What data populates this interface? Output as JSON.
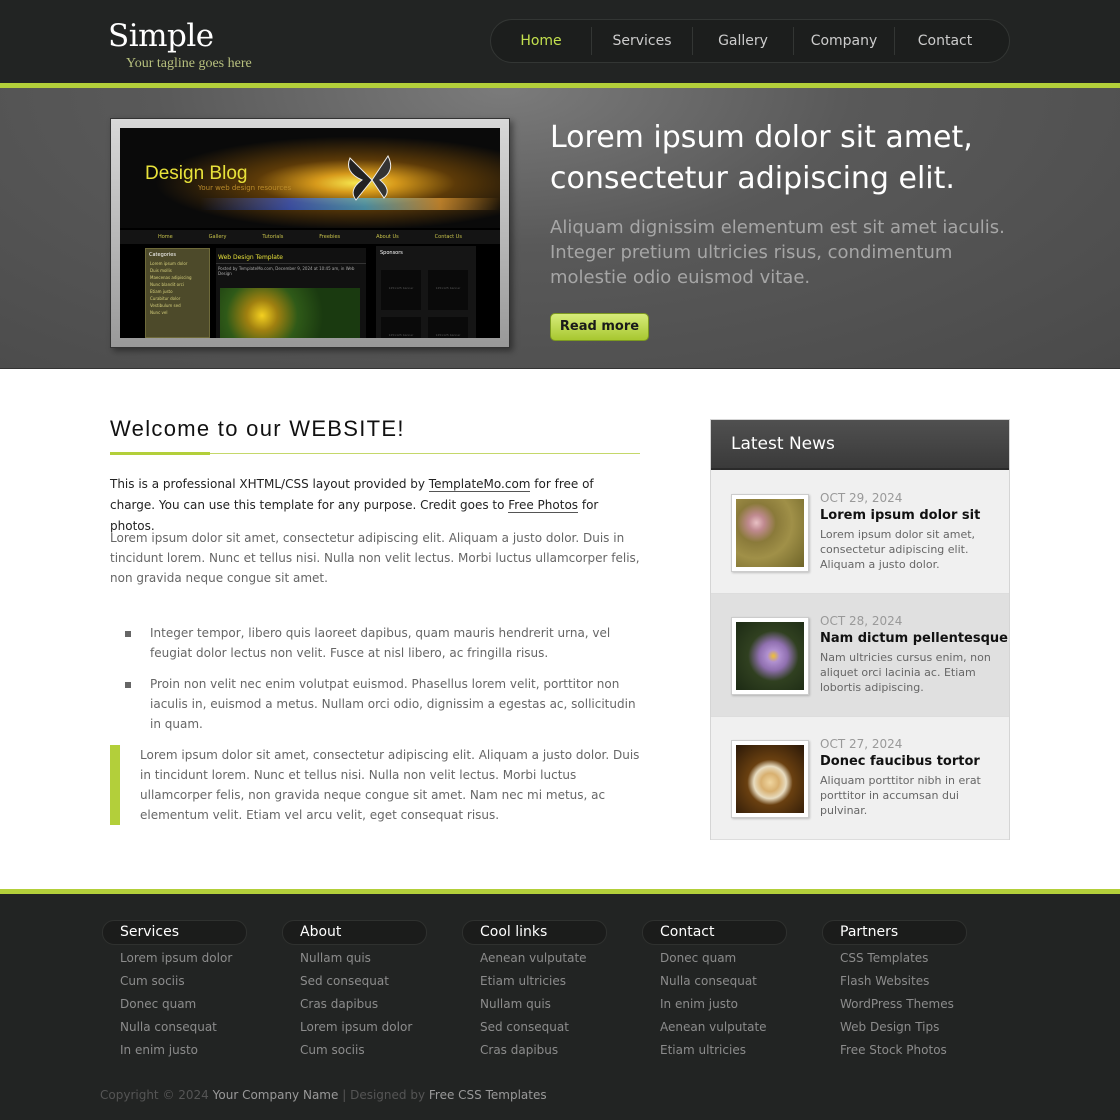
{
  "header": {
    "logo_title": "Simple",
    "logo_tagline": "Your tagline goes here",
    "nav": [
      "Home",
      "Services",
      "Gallery",
      "Company",
      "Contact"
    ]
  },
  "hero": {
    "preview": {
      "title": "Design Blog",
      "subtitle": "Your web design resources",
      "nav": [
        "Home",
        "Gallery",
        "Tutorials",
        "Freebies",
        "About Us",
        "Contact Us"
      ],
      "categories_title": "Categories",
      "categories": [
        "Lorem ipsum dolor",
        "Duis mollis",
        "Maecenas adipiscing",
        "Nunc blandit orci",
        "Etiam justo",
        "Curabitur dolor",
        "Vestibulum sed",
        "Nunc vel"
      ],
      "post_title": "Web Design Template",
      "post_meta": "Posted by TemplateMo.com, December 9, 2024 at 10:45 am, in Web Design",
      "sponsors_title": "Sponsors",
      "sponsor_box": "125x125 banner"
    },
    "heading": "Lorem ipsum dolor sit amet, consectetur adipiscing elit.",
    "text": "Aliquam dignissim elementum est sit amet iaculis. Integer pretium ultricies risus, condimentum molestie odio euismod vitae.",
    "button": "Read more"
  },
  "main": {
    "title": "Welcome to our WEBSITE!",
    "intro_a": "This is a professional XHTML/CSS layout provided by ",
    "intro_link1": "TemplateMo.com",
    "intro_b": " for free of charge. You can use this template for any purpose. Credit goes to ",
    "intro_link2": "Free Photos",
    "intro_c": " for photos.",
    "paragraph": "Lorem ipsum dolor sit amet, consectetur adipiscing elit. Aliquam a justo dolor. Duis in tincidunt lorem. Nunc et tellus nisi. Nulla non velit lectus. Morbi luctus ullamcorper felis, non gravida neque congue sit amet.",
    "bullets": [
      "Integer tempor, libero quis laoreet dapibus, quam mauris hendrerit urna, vel feugiat dolor lectus non velit. Fusce at nisl libero, ac fringilla risus.",
      "Proin non velit nec enim volutpat euismod. Phasellus lorem velit, porttitor non iaculis in, euismod a metus. Nullam orci odio, dignissim a egestas ac, sollicitudin in quam."
    ],
    "quote": "Lorem ipsum dolor sit amet, consectetur adipiscing elit. Aliquam a justo dolor. Duis in tincidunt lorem. Nunc et tellus nisi. Nulla non velit lectus. Morbi luctus ullamcorper felis, non gravida neque congue sit amet. Nam nec mi metus, ac elementum velit. Etiam vel arcu velit, eget consequat risus."
  },
  "news": {
    "title": "Latest News",
    "items": [
      {
        "date": "OCT 29, 2024",
        "title": "Lorem ipsum dolor sit",
        "text": "Lorem ipsum dolor sit amet, consectetur adipiscing elit. Aliquam a justo dolor."
      },
      {
        "date": "OCT 28, 2024",
        "title": "Nam dictum pellentesque",
        "text": "Nam ultricies cursus enim, non aliquet orci lacinia ac. Etiam lobortis adipiscing."
      },
      {
        "date": "OCT 27, 2024",
        "title": "Donec faucibus tortor",
        "text": "Aliquam porttitor nibh in erat porttitor in accumsan dui pulvinar."
      }
    ]
  },
  "footer": {
    "columns": [
      {
        "title": "Services",
        "links": [
          "Lorem ipsum dolor",
          "Cum sociis",
          "Donec quam",
          "Nulla consequat",
          "In enim justo"
        ]
      },
      {
        "title": "About",
        "links": [
          "Nullam quis",
          "Sed consequat",
          "Cras dapibus",
          "Lorem ipsum dolor",
          "Cum sociis"
        ]
      },
      {
        "title": "Cool links",
        "links": [
          "Aenean vulputate",
          "Etiam ultricies",
          "Nullam quis",
          "Sed consequat",
          "Cras dapibus"
        ]
      },
      {
        "title": "Contact",
        "links": [
          "Donec quam",
          "Nulla consequat",
          "In enim justo",
          "Aenean vulputate",
          "Etiam ultricies"
        ]
      },
      {
        "title": "Partners",
        "links": [
          "CSS Templates",
          "Flash Websites",
          "WordPress Themes",
          "Web Design Tips",
          "Free Stock Photos"
        ]
      }
    ],
    "copyright_prefix": "Copyright © 2024",
    "company": "Your Company Name",
    "designed_by": "| Designed by",
    "designer": "Free CSS Templates"
  },
  "colors": {
    "accent": "#b3cf3a",
    "header_bg": "#222423",
    "nav_active": "#c3e04e"
  }
}
